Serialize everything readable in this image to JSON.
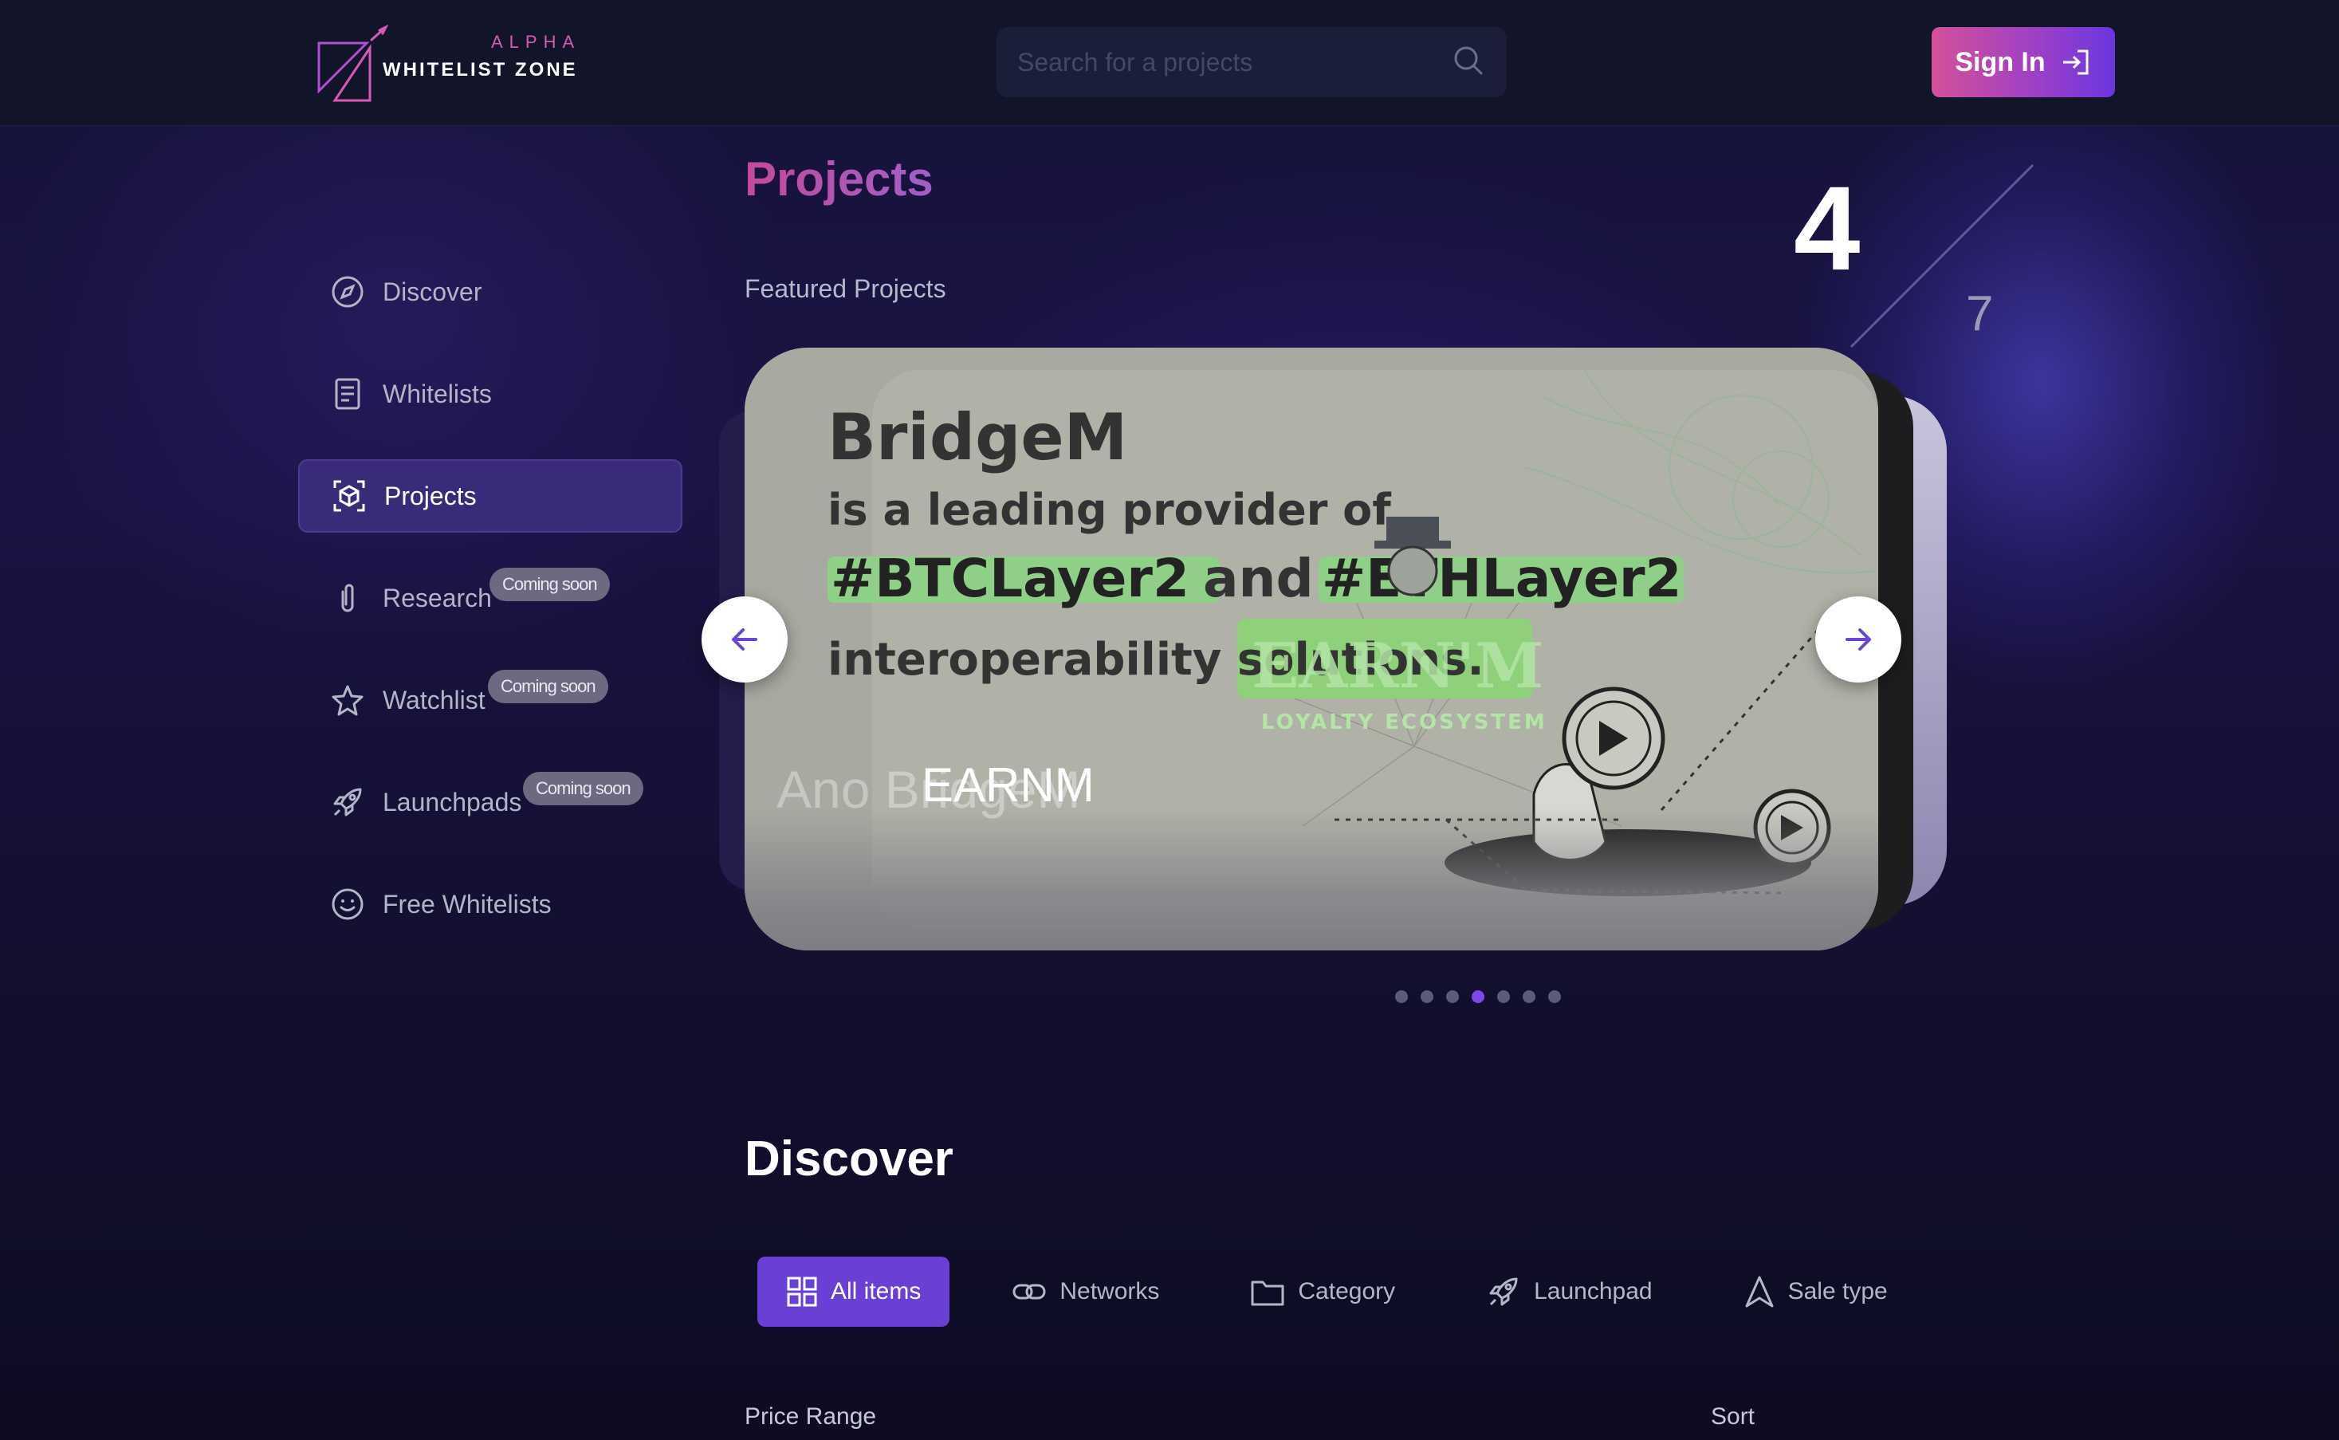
{
  "header": {
    "logo_top": "ALPHA",
    "logo_bottom": "WHITELIST ZONE",
    "search_placeholder": "Search for a projects",
    "signin_label": "Sign In"
  },
  "sidebar": {
    "items": [
      {
        "label": "Discover",
        "icon": "compass-icon",
        "active": false
      },
      {
        "label": "Whitelists",
        "icon": "receipt-icon",
        "active": false
      },
      {
        "label": "Projects",
        "icon": "cube-scan-icon",
        "active": true
      },
      {
        "label": "Research",
        "icon": "paperclip-icon",
        "badge": "Coming soon"
      },
      {
        "label": "Watchlist",
        "icon": "star-icon",
        "badge": "Coming soon"
      },
      {
        "label": "Launchpads",
        "icon": "rocket-icon",
        "badge": "Coming soon"
      },
      {
        "label": "Free Whitelists",
        "icon": "smiley-icon"
      }
    ]
  },
  "main": {
    "title": "Projects",
    "featured_label": "Featured Projects",
    "counter_current": "4",
    "counter_total": "7",
    "carousel": {
      "card_title": "EARNM",
      "ghost_text": "Ano BridgeM",
      "art": {
        "line1": "BridgeM",
        "line2": "is a leading provider of",
        "tag1": "#BTCLayer2",
        "and": "and",
        "tag2": "#ETHLayer2",
        "line4": "interoperability solutions.",
        "brand": "EARN'M",
        "brand_sub": "LOYALTY ECOSYSTEM"
      },
      "dots": 7,
      "active_dot": 4
    },
    "discover_title": "Discover",
    "filters": [
      {
        "label": "All items",
        "icon": "grid-icon",
        "active": true
      },
      {
        "label": "Networks",
        "icon": "link-icon",
        "active": false
      },
      {
        "label": "Category",
        "icon": "folder-icon",
        "active": false
      },
      {
        "label": "Launchpad",
        "icon": "rocket-icon",
        "active": false
      },
      {
        "label": "Sale type",
        "icon": "navigation-arrow-icon",
        "active": false
      }
    ],
    "price_range_label": "Price Range",
    "sort_label": "Sort"
  },
  "colors": {
    "accent": "#6a3fd4",
    "brand_pink": "#d4509a",
    "background": "#0e0d24"
  }
}
